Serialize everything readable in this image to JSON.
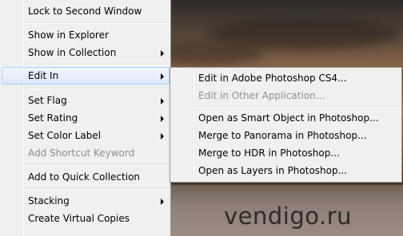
{
  "main_menu": {
    "items": [
      {
        "label": "Lock to Second Window",
        "submenu": false,
        "disabled": false
      },
      {
        "label": "Show in Explorer",
        "submenu": false,
        "disabled": false
      },
      {
        "label": "Show in Collection",
        "submenu": true,
        "disabled": false
      },
      {
        "label": "Edit In",
        "submenu": true,
        "disabled": false,
        "highlighted": true
      },
      {
        "label": "Set Flag",
        "submenu": true,
        "disabled": false
      },
      {
        "label": "Set Rating",
        "submenu": true,
        "disabled": false
      },
      {
        "label": "Set Color Label",
        "submenu": true,
        "disabled": false
      },
      {
        "label": "Add Shortcut Keyword",
        "submenu": false,
        "disabled": true
      },
      {
        "label": "Add to Quick Collection",
        "submenu": false,
        "disabled": false
      },
      {
        "label": "Stacking",
        "submenu": true,
        "disabled": false
      },
      {
        "label": "Create Virtual Copies",
        "submenu": false,
        "disabled": false
      }
    ]
  },
  "edit_in_submenu": {
    "items": [
      {
        "label": "Edit in Adobe Photoshop CS4...",
        "disabled": false
      },
      {
        "label": "Edit in Other Application...",
        "disabled": true
      },
      {
        "label": "Open as Smart Object in Photoshop...",
        "disabled": false
      },
      {
        "label": "Merge to Panorama in Photoshop...",
        "disabled": false
      },
      {
        "label": "Merge to HDR in Photoshop...",
        "disabled": false
      },
      {
        "label": "Open as Layers in Photoshop...",
        "disabled": false
      }
    ]
  },
  "watermark": "vendigo.ru",
  "colors": {
    "menu_bg": "#f0f0f0",
    "highlight_border": "#aecff7",
    "disabled_text": "#8d8d8d"
  }
}
